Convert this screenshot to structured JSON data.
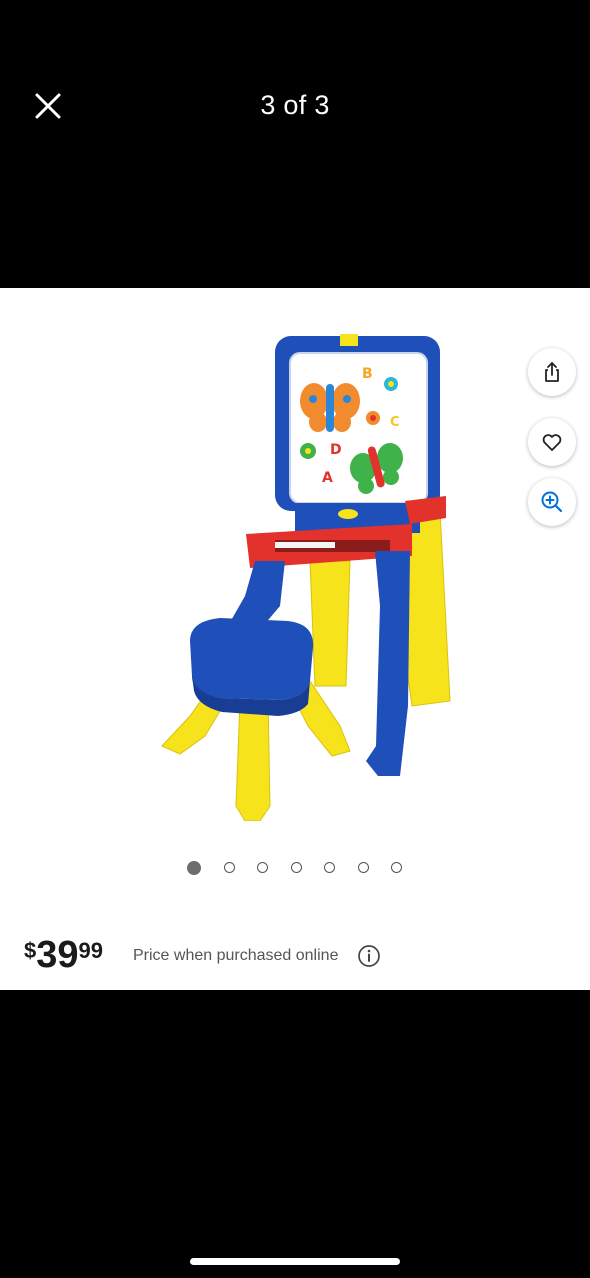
{
  "header": {
    "counter": "3 of 3",
    "close_icon": "close-icon"
  },
  "product": {
    "image_alt": "Crayola easel with stool",
    "logo_text": "crayola"
  },
  "actions": [
    {
      "name": "share-button",
      "icon": "share-icon"
    },
    {
      "name": "favorite-button",
      "icon": "heart-icon"
    },
    {
      "name": "zoom-button",
      "icon": "zoom-in-icon"
    }
  ],
  "carousel": {
    "total": 7,
    "active_index": 0
  },
  "price": {
    "currency": "$",
    "whole": "39",
    "cents": "99",
    "note": "Price when purchased online",
    "info_icon": "info-icon"
  },
  "colors": {
    "accent": "#0071dc",
    "background": "#000000",
    "panel": "#ffffff"
  }
}
